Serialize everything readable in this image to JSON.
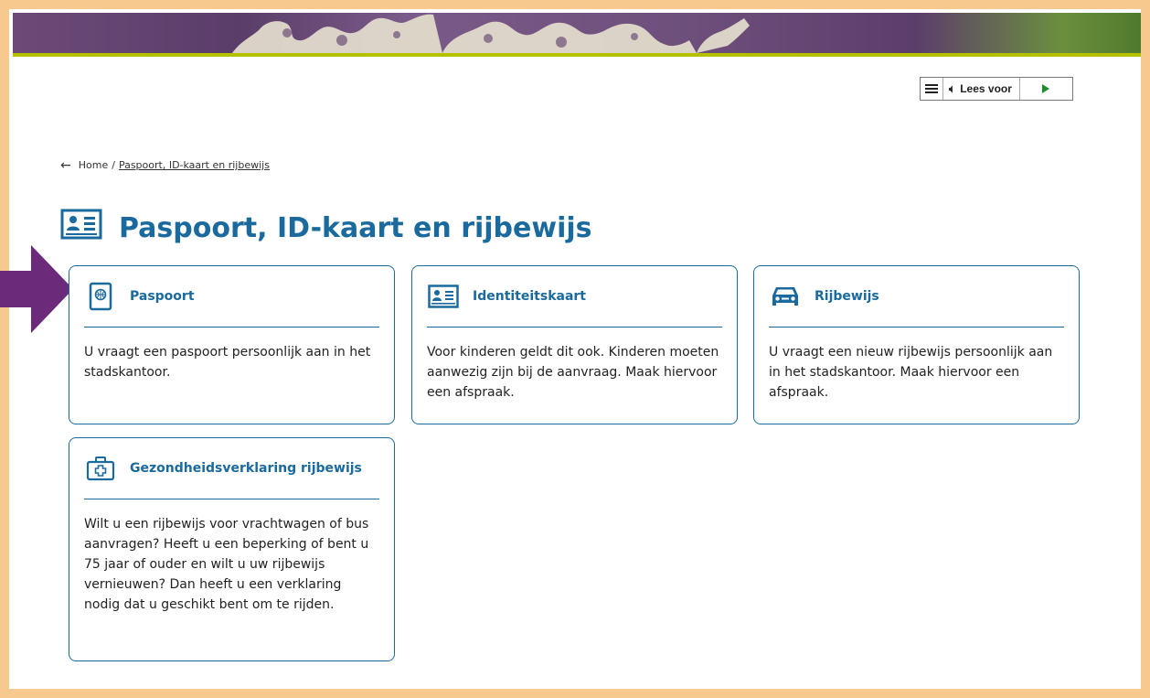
{
  "readspeaker": {
    "listen_label": "Lees voor",
    "menu_icon": "hamburger-menu-icon",
    "speaker_icon": "speaker-icon",
    "play_icon": "play-icon"
  },
  "breadcrumb": {
    "home": "Home",
    "separator": "/",
    "current": "Paspoort, ID-kaart en rijbewijs"
  },
  "page": {
    "title": "Paspoort, ID-kaart en rijbewijs",
    "title_icon": "id-card-icon"
  },
  "colors": {
    "accent": "#1a6a9e",
    "frame": "#f7c98f",
    "arrow": "#6b2a7a",
    "banner_stripe": "#b5c100"
  },
  "cards": [
    {
      "title": "Paspoort",
      "icon": "passport-icon",
      "text": "U vraagt een paspoort persoonlijk aan in het stadskantoor."
    },
    {
      "title": "Identiteitskaart",
      "icon": "id-card-icon",
      "text": "Voor kinderen geldt dit ook. Kinderen moeten aanwezig zijn bij de aanvraag. Maak hiervoor een afspraak."
    },
    {
      "title": "Rijbewijs",
      "icon": "car-icon",
      "text": "U vraagt een nieuw rijbewijs persoonlijk aan in het stadskantoor. Maak hiervoor een afspraak."
    },
    {
      "title": "Gezondheidsverklaring rijbewijs",
      "icon": "medical-kit-icon",
      "text": "Wilt u een rijbewijs voor vrachtwagen of bus aanvragen? Heeft u een beperking of bent u 75 jaar of ouder en wilt u uw rijbewijs vernieuwen? Dan heeft u een verklaring nodig dat u geschikt bent om te rijden."
    }
  ]
}
